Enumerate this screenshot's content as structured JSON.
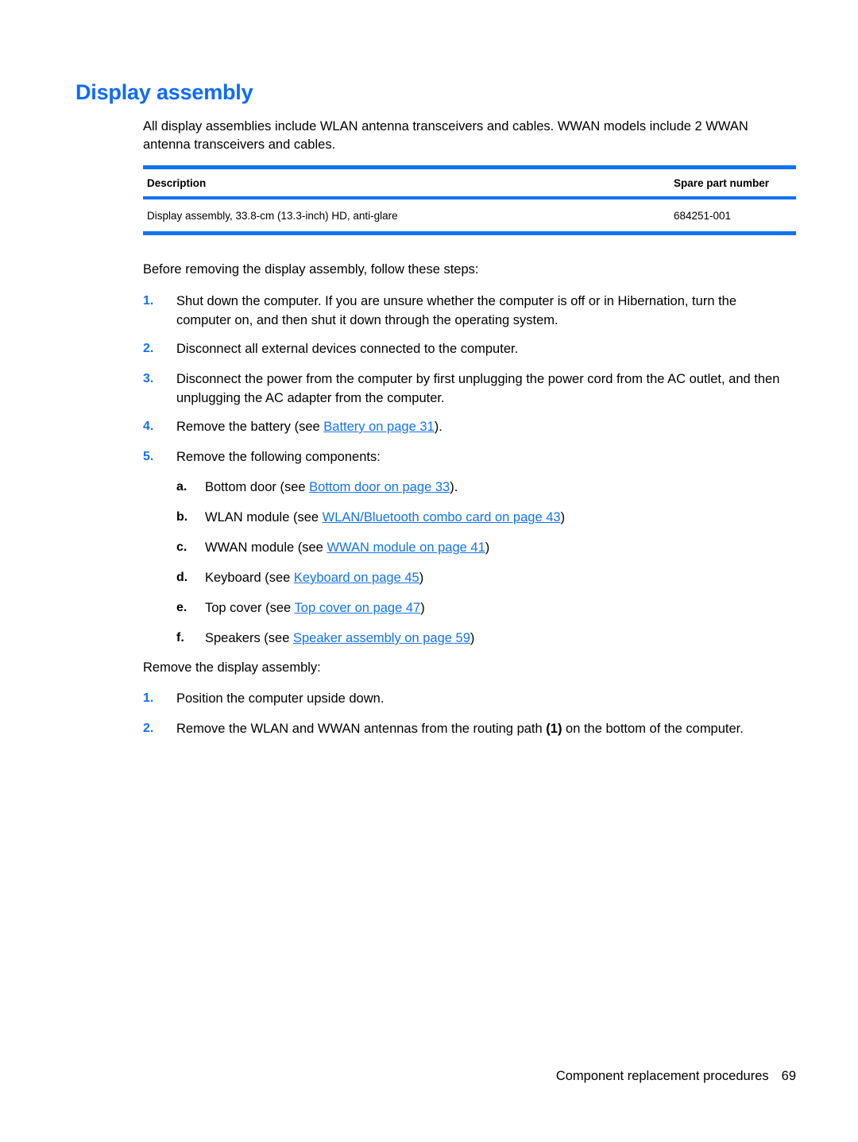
{
  "heading": "Display assembly",
  "intro": "All display assemblies include WLAN antenna transceivers and cables. WWAN models include 2 WWAN antenna transceivers and cables.",
  "table": {
    "headers": {
      "description": "Description",
      "spare_part_number": "Spare part number"
    },
    "rows": [
      {
        "description": "Display assembly, 33.8-cm (13.3-inch) HD, anti-glare",
        "spare_part_number": "684251-001"
      }
    ]
  },
  "before_section": {
    "lead": "Before removing the display assembly, follow these steps:",
    "steps": [
      {
        "marker": "1.",
        "text": "Shut down the computer. If you are unsure whether the computer is off or in Hibernation, turn the computer on, and then shut it down through the operating system."
      },
      {
        "marker": "2.",
        "text": "Disconnect all external devices connected to the computer."
      },
      {
        "marker": "3.",
        "text": "Disconnect the power from the computer by first unplugging the power cord from the AC outlet, and then unplugging the AC adapter from the computer."
      },
      {
        "marker": "4.",
        "prefix": "Remove the battery (see ",
        "link": "Battery on page 31",
        "suffix": ")."
      },
      {
        "marker": "5.",
        "text": "Remove the following components:"
      }
    ],
    "substeps": [
      {
        "marker": "a.",
        "prefix": "Bottom door (see ",
        "link": "Bottom door on page 33",
        "suffix": ")."
      },
      {
        "marker": "b.",
        "prefix": "WLAN module (see ",
        "link": "WLAN/Bluetooth combo card on page 43",
        "suffix": ")"
      },
      {
        "marker": "c.",
        "prefix": "WWAN module (see ",
        "link": "WWAN module on page 41",
        "suffix": ")"
      },
      {
        "marker": "d.",
        "prefix": "Keyboard (see ",
        "link": "Keyboard on page 45",
        "suffix": ")"
      },
      {
        "marker": "e.",
        "prefix": "Top cover (see ",
        "link": "Top cover on page 47",
        "suffix": ")"
      },
      {
        "marker": "f.",
        "prefix": "Speakers (see ",
        "link": "Speaker assembly on page 59",
        "suffix": ")"
      }
    ]
  },
  "remove_section": {
    "lead": "Remove the display assembly:",
    "steps": [
      {
        "marker": "1.",
        "text": "Position the computer upside down."
      },
      {
        "marker": "2.",
        "prefix": "Remove the WLAN and WWAN antennas from the routing path ",
        "callout": "(1)",
        "suffix": " on the bottom of the computer."
      }
    ]
  },
  "footer": {
    "label": "Component replacement procedures",
    "page_number": "69"
  },
  "colors": {
    "accent_blue": "#1273f0",
    "heading_blue": "#0f6bfa",
    "text_black": "#000000"
  }
}
